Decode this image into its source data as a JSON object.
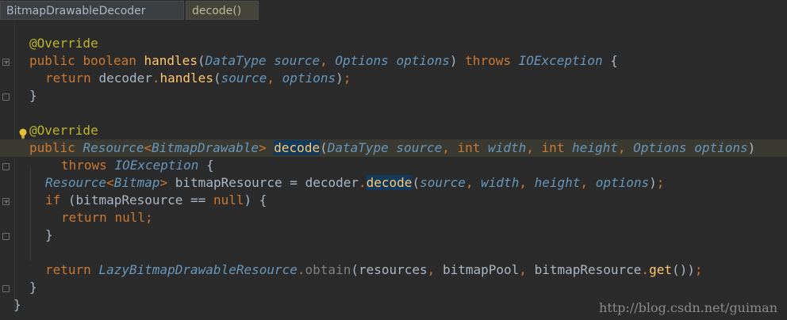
{
  "breadcrumb": {
    "class_name": "BitmapDrawableDecoder",
    "method_name": "decode()"
  },
  "watermark": "http://blog.csdn.net/guiman",
  "code": {
    "l1": {
      "annotation": "@Override"
    },
    "l2": {
      "kw_public": "public",
      "kw_boolean": "boolean",
      "method": "handles",
      "paren_open": "(",
      "type1": "DataType",
      "param1": "source",
      "comma1": ",",
      "type2": "Options",
      "param2": "options",
      "paren_close": ")",
      "kw_throws": "throws",
      "exception": "IOException",
      "brace": "{"
    },
    "l3": {
      "kw_return": "return",
      "target": "decoder",
      "dot": ".",
      "call": "handles",
      "paren_open": "(",
      "arg1": "source",
      "comma": ",",
      "arg2": "options",
      "paren_close": ")",
      "semi": ";"
    },
    "l4": {
      "brace": "}"
    },
    "l6": {
      "annotation": "@Override"
    },
    "l7": {
      "kw_public": "public",
      "ret_type": "Resource",
      "lt": "<",
      "generic": "BitmapDrawable",
      "gt": ">",
      "method": "decode",
      "paren_open": "(",
      "type1": "DataType",
      "param1": "source",
      "comma1": ",",
      "kw_int1": "int",
      "param2": "width",
      "comma2": ",",
      "kw_int2": "int",
      "param3": "height",
      "comma3": ",",
      "type4": "Options",
      "param4": "options",
      "paren_close": ")"
    },
    "l8": {
      "kw_throws": "throws",
      "exception": "IOException",
      "brace": "{"
    },
    "l9": {
      "type": "Resource",
      "lt": "<",
      "generic": "Bitmap",
      "gt": ">",
      "var": "bitmapResource",
      "eq": "=",
      "target": "decoder",
      "dot": ".",
      "call": "decode",
      "paren_open": "(",
      "arg1": "source",
      "c1": ",",
      "arg2": "width",
      "c2": ",",
      "arg3": "height",
      "c3": ",",
      "arg4": "options",
      "paren_close": ")",
      "semi": ";"
    },
    "l10": {
      "kw_if": "if",
      "cond_open": "(",
      "var": "bitmapResource",
      "op": "==",
      "kw_null": "null",
      "cond_close": ")",
      "brace": "{"
    },
    "l11": {
      "kw_return": "return",
      "kw_null": "null",
      "semi": ";"
    },
    "l12": {
      "brace": "}"
    },
    "l14": {
      "kw_return": "return",
      "cls": "LazyBitmapDrawableResource",
      "dot": ".",
      "static_call": "obtain",
      "paren_open": "(",
      "arg1": "resources",
      "c1": ",",
      "arg2": "bitmapPool",
      "c2": ",",
      "arg3": "bitmapResource",
      "dot2": ".",
      "call2": "get",
      "inner": "()",
      "paren_close": ")",
      "semi": ";"
    },
    "l15": {
      "brace": "}"
    },
    "l16": {
      "brace": "}"
    }
  }
}
